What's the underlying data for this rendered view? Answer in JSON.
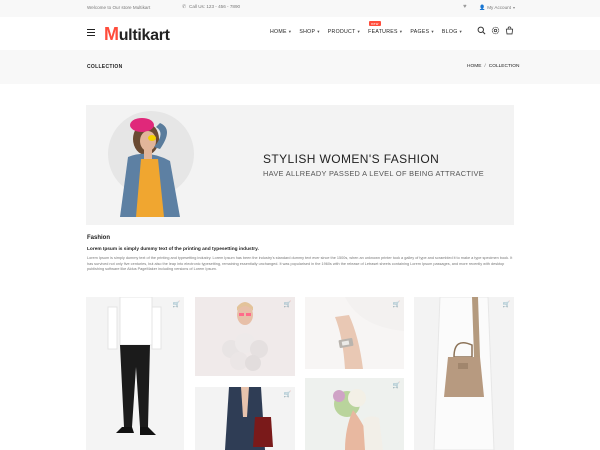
{
  "topbar": {
    "welcome": "Welcome to Our store Multikart",
    "phone": "Call Us: 123 - 456 - 7890",
    "account": "My Account"
  },
  "header": {
    "logo_first": "M",
    "logo_rest": "ultikart",
    "nav": [
      {
        "label": "HOME"
      },
      {
        "label": "SHOP"
      },
      {
        "label": "PRODUCT"
      },
      {
        "label": "FEATURES",
        "badge": "new"
      },
      {
        "label": "PAGES"
      },
      {
        "label": "BLOG"
      }
    ]
  },
  "breadcrumb": {
    "title": "COLLECTION",
    "home": "HOME",
    "separator": "/",
    "current": "COLLECTION"
  },
  "banner": {
    "headline": "STYLISH WOMEN'S FASHION",
    "subheadline": "HAVE ALLREADY PASSED A LEVEL OF BEING ATTRACTIVE"
  },
  "description": {
    "category": "Fashion",
    "lead": "Lorem Ipsum is simply dummy text of the printing and typesetting industry.",
    "body": "Lorem Ipsum is simply dummy text of the printing and typesetting industry. Lorem Ipsum has been the industry's standard dummy text ever since the 1500s, when an unknown printer took a galley of type and scrambled it to make a type specimen book. It has survived not only five centuries, but also the leap into electronic typesetting, remaining essentially unchanged. It was popularised in the 1960s with the release of Letraset sheets containing Lorem Ipsum passages, and more recently with desktop publishing software like Aldus PageMaker including versions of Lorem Ipsum."
  },
  "colors": {
    "accent": "#ff4c3b",
    "strip_bg": "#f8f8f8"
  },
  "icons": [
    "phone-icon",
    "heart-icon",
    "user-icon",
    "menu-icon",
    "search-icon",
    "settings-icon",
    "cart-icon"
  ]
}
